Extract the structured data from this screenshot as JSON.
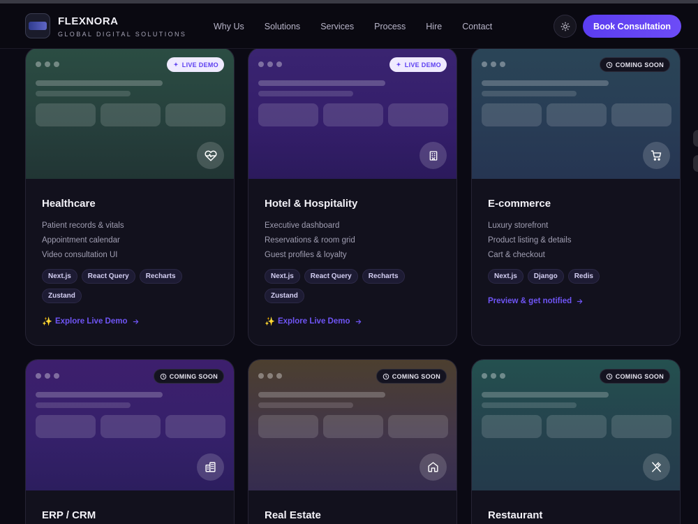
{
  "header": {
    "brand": "FLEXNORA",
    "tagline": "GLOBAL DIGITAL SOLUTIONS",
    "nav": [
      "Why Us",
      "Solutions",
      "Services",
      "Process",
      "Hire",
      "Contact"
    ],
    "cta_label": "Book Consultation",
    "theme_icon": "sun-icon"
  },
  "colors": {
    "accent": "#6d4cf7",
    "live_badge_text": "#5b3df0",
    "spark": "#f3c24a"
  },
  "cards": [
    {
      "title": "Healthcare",
      "badge": "LIVE DEMO",
      "badge_type": "live",
      "icon": "heart-pulse-icon",
      "features": [
        "Patient records & vitals",
        "Appointment calendar",
        "Video consultation UI"
      ],
      "tags": [
        "Next.js",
        "React Query",
        "Recharts",
        "Zustand"
      ],
      "cta": "Explore Live Demo",
      "cta_type": "live"
    },
    {
      "title": "Hotel & Hospitality",
      "badge": "LIVE DEMO",
      "badge_type": "live",
      "icon": "building-icon",
      "features": [
        "Executive dashboard",
        "Reservations & room grid",
        "Guest profiles & loyalty"
      ],
      "tags": [
        "Next.js",
        "React Query",
        "Recharts",
        "Zustand"
      ],
      "cta": "Explore Live Demo",
      "cta_type": "live"
    },
    {
      "title": "E-commerce",
      "badge": "COMING SOON",
      "badge_type": "soon",
      "icon": "cart-icon",
      "features": [
        "Luxury storefront",
        "Product listing & details",
        "Cart & checkout"
      ],
      "tags": [
        "Next.js",
        "Django",
        "Redis"
      ],
      "cta": "Preview & get notified",
      "cta_type": "soon"
    },
    {
      "title": "ERP / CRM",
      "badge": "COMING SOON",
      "badge_type": "soon",
      "icon": "office-icon"
    },
    {
      "title": "Real Estate",
      "badge": "COMING SOON",
      "badge_type": "soon",
      "icon": "home-icon"
    },
    {
      "title": "Restaurant",
      "badge": "COMING SOON",
      "badge_type": "soon",
      "icon": "utensils-icon"
    }
  ]
}
